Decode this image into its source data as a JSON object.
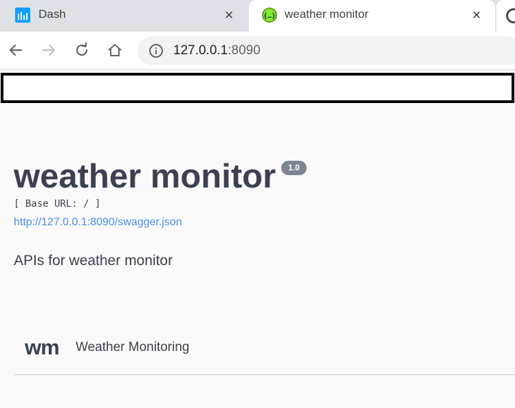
{
  "browser": {
    "tabs": [
      {
        "title": "Dash",
        "icon": "dash-icon",
        "active": false
      },
      {
        "title": "weather monitor",
        "icon": "swagger-icon",
        "active": true
      }
    ],
    "close_glyph": "×",
    "url_host": "127.0.0.1",
    "url_port": ":8090"
  },
  "api": {
    "title": "weather monitor",
    "version": "1.0",
    "base_url": "[ Base URL: / ]",
    "spec_link": "http://127.0.0.1:8090/swagger.json",
    "description": "APIs for weather monitor"
  },
  "tags": [
    {
      "name": "wm",
      "description": "Weather Monitoring"
    }
  ],
  "colors": {
    "tabstrip": "#dee1e6",
    "text": "#3b4151",
    "link": "#4990e2",
    "badge": "#7d8492",
    "dash_icon": "#119dff",
    "swagger_icon": "#85ea2d"
  }
}
